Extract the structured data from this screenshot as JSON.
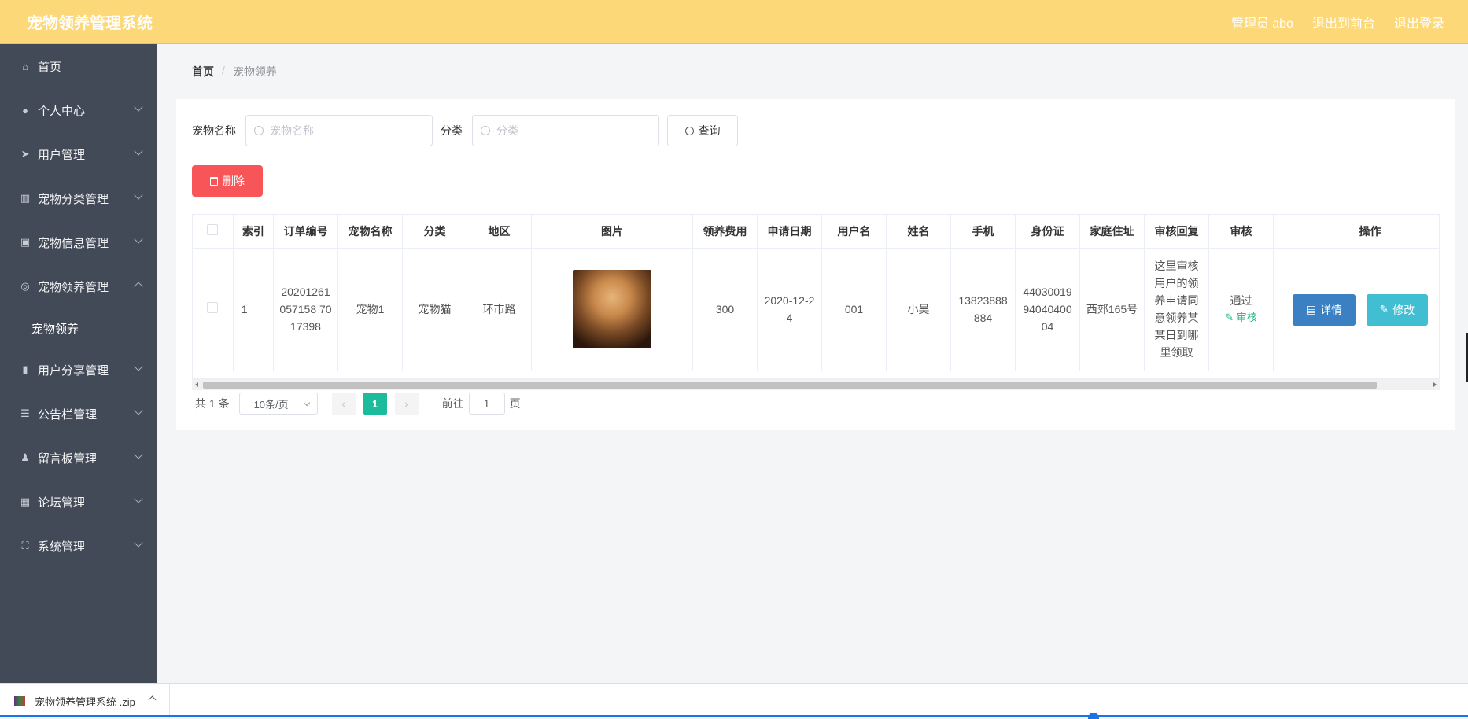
{
  "header": {
    "app_title": "宠物领养管理系统",
    "admin_label": "管理员 abo",
    "to_front": "退出到前台",
    "logout": "退出登录"
  },
  "sidebar": {
    "items": [
      {
        "label": "首页",
        "icon": "home-icon"
      },
      {
        "label": "个人中心",
        "icon": "user-icon"
      },
      {
        "label": "用户管理",
        "icon": "send-icon"
      },
      {
        "label": "宠物分类管理",
        "icon": "chart-icon"
      },
      {
        "label": "宠物信息管理",
        "icon": "camera-icon"
      },
      {
        "label": "宠物领养管理",
        "icon": "circle-icon",
        "expanded": true,
        "sub": [
          "宠物领养"
        ]
      },
      {
        "label": "用户分享管理",
        "icon": "bar-chart-icon"
      },
      {
        "label": "公告栏管理",
        "icon": "list-icon"
      },
      {
        "label": "留言板管理",
        "icon": "person-icon"
      },
      {
        "label": "论坛管理",
        "icon": "grid-icon"
      },
      {
        "label": "系统管理",
        "icon": "fullscreen-icon"
      }
    ]
  },
  "breadcrumb": {
    "home": "首页",
    "current": "宠物领养"
  },
  "search": {
    "name_label": "宠物名称",
    "name_placeholder": "宠物名称",
    "category_label": "分类",
    "category_placeholder": "分类",
    "query_button": "查询"
  },
  "actions": {
    "delete_button": "删除"
  },
  "table": {
    "headers": [
      "索引",
      "订单编号",
      "宠物名称",
      "分类",
      "地区",
      "图片",
      "领养费用",
      "申请日期",
      "用户名",
      "姓名",
      "手机",
      "身份证",
      "家庭住址",
      "审核回复",
      "审核",
      "操作"
    ],
    "rows": [
      {
        "index": "1",
        "order_no": "20201261057158 7017398",
        "pet_name": "宠物1",
        "category": "宠物猫",
        "region": "环市路",
        "fee": "300",
        "apply_date": "2020-12-24",
        "username": "001",
        "name": "小吴",
        "phone": "13823888884",
        "id_card": "440300199404040004",
        "address": "西郊165号",
        "audit_reply": "这里审核用户的领养申请同意领养某某日到哪里领取",
        "audit_status": "通过",
        "audit_link": "审核",
        "btn_detail": "详情",
        "btn_edit": "修改"
      }
    ]
  },
  "pagination": {
    "total": "共 1 条",
    "page_size": "10条/页",
    "current_page": "1",
    "goto_prefix": "前往",
    "goto_value": "1",
    "goto_suffix": "页"
  },
  "download_bar": {
    "filename": "宠物领养管理系统 .zip"
  },
  "colors": {
    "header": "#fdd878",
    "sidebar": "#434a57",
    "delete": "#f75557",
    "detail": "#3a80c2",
    "edit": "#42bed3",
    "active_page": "#1abc9c"
  }
}
